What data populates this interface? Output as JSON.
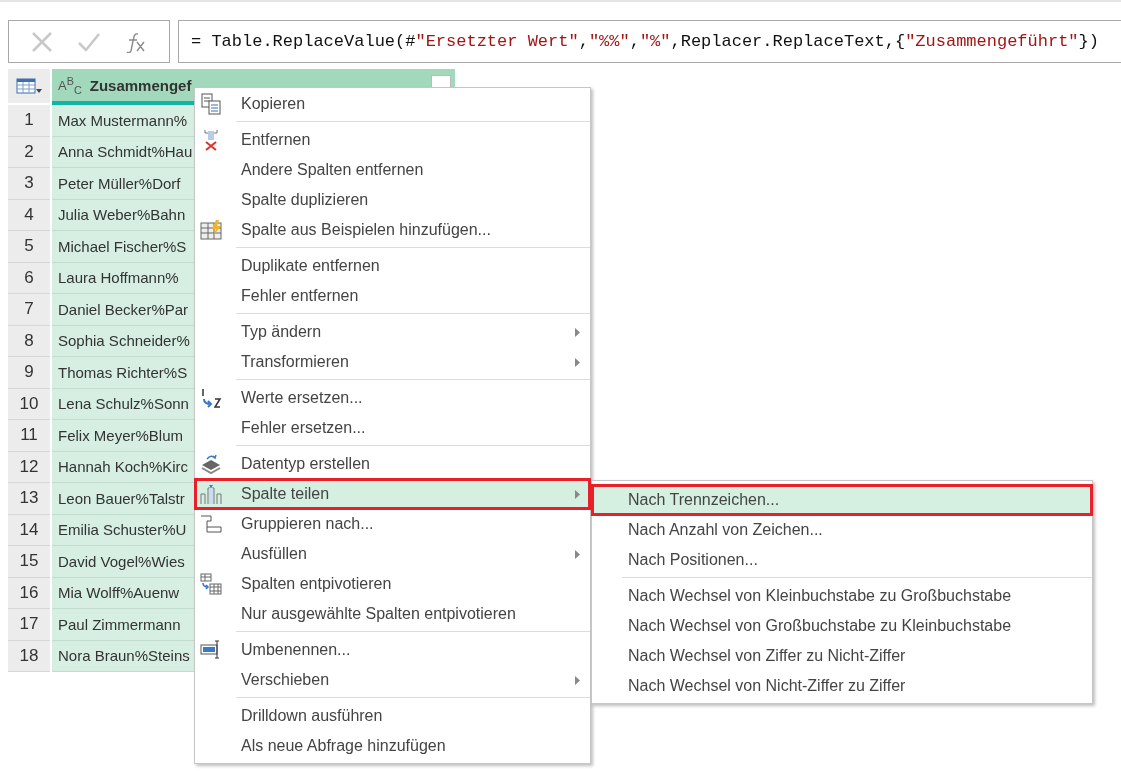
{
  "formula_bar": {
    "segments": [
      {
        "kind": "code",
        "text": "= Table.ReplaceValue(#"
      },
      {
        "kind": "string",
        "text": "\"Ersetzter Wert\""
      },
      {
        "kind": "code",
        "text": ","
      },
      {
        "kind": "string",
        "text": "\"%%\""
      },
      {
        "kind": "code",
        "text": ","
      },
      {
        "kind": "string",
        "text": "\"%\""
      },
      {
        "kind": "code",
        "text": ",Replacer.ReplaceText,{"
      },
      {
        "kind": "string",
        "text": "\"Zusammengeführt\""
      },
      {
        "kind": "code",
        "text": "})"
      }
    ]
  },
  "table": {
    "column": {
      "type_label": "A$^{B}$$_{C}$",
      "title": "Zusammengef"
    },
    "rows": [
      {
        "index": "1",
        "value": "Max Mustermann%"
      },
      {
        "index": "2",
        "value": "Anna Schmidt%Hau"
      },
      {
        "index": "3",
        "value": "Peter Müller%Dorf"
      },
      {
        "index": "4",
        "value": "Julia Weber%Bahn"
      },
      {
        "index": "5",
        "value": "Michael Fischer%S"
      },
      {
        "index": "6",
        "value": "Laura Hoffmann%"
      },
      {
        "index": "7",
        "value": "Daniel Becker%Par"
      },
      {
        "index": "8",
        "value": "Sophia Schneider%"
      },
      {
        "index": "9",
        "value": "Thomas Richter%S"
      },
      {
        "index": "10",
        "value": "Lena Schulz%Sonn"
      },
      {
        "index": "11",
        "value": "Felix Meyer%Blum"
      },
      {
        "index": "12",
        "value": "Hannah Koch%Kirc"
      },
      {
        "index": "13",
        "value": "Leon Bauer%Talstr"
      },
      {
        "index": "14",
        "value": "Emilia Schuster%U"
      },
      {
        "index": "15",
        "value": "David Vogel%Wies"
      },
      {
        "index": "16",
        "value": "Mia Wolff%Auenw"
      },
      {
        "index": "17",
        "value": "Paul Zimmermann"
      },
      {
        "index": "18",
        "value": "Nora Braun%Steins"
      }
    ]
  },
  "context_menu": {
    "sections": [
      [
        {
          "label": "Kopieren",
          "submenu": false,
          "selected": false
        }
      ],
      [
        {
          "label": "Entfernen",
          "submenu": false,
          "selected": false
        },
        {
          "label": "Andere Spalten entfernen",
          "submenu": false,
          "selected": false
        },
        {
          "label": "Spalte duplizieren",
          "submenu": false,
          "selected": false
        },
        {
          "label": "Spalte aus Beispielen hinzufügen...",
          "submenu": false,
          "selected": false
        }
      ],
      [
        {
          "label": "Duplikate entfernen",
          "submenu": false,
          "selected": false
        },
        {
          "label": "Fehler entfernen",
          "submenu": false,
          "selected": false
        }
      ],
      [
        {
          "label": "Typ ändern",
          "submenu": true,
          "selected": false
        },
        {
          "label": "Transformieren",
          "submenu": true,
          "selected": false
        }
      ],
      [
        {
          "label": "Werte ersetzen...",
          "submenu": false,
          "selected": false
        },
        {
          "label": "Fehler ersetzen...",
          "submenu": false,
          "selected": false
        }
      ],
      [
        {
          "label": "Datentyp erstellen",
          "submenu": false,
          "selected": false
        },
        {
          "label": "Spalte teilen",
          "submenu": true,
          "selected": true
        },
        {
          "label": "Gruppieren nach...",
          "submenu": false,
          "selected": false
        },
        {
          "label": "Ausfüllen",
          "submenu": true,
          "selected": false
        },
        {
          "label": "Spalten entpivotieren",
          "submenu": false,
          "selected": false
        },
        {
          "label": "Nur ausgewählte Spalten entpivotieren",
          "submenu": false,
          "selected": false
        }
      ],
      [
        {
          "label": "Umbenennen...",
          "submenu": false,
          "selected": false
        },
        {
          "label": "Verschieben",
          "submenu": true,
          "selected": false
        }
      ],
      [
        {
          "label": "Drilldown ausführen",
          "submenu": false,
          "selected": false
        },
        {
          "label": "Als neue Abfrage hinzufügen",
          "submenu": false,
          "selected": false
        }
      ]
    ]
  },
  "submenu": {
    "sections": [
      [
        {
          "label": "Nach Trennzeichen...",
          "selected": true
        },
        {
          "label": "Nach Anzahl von Zeichen...",
          "selected": false
        },
        {
          "label": "Nach Positionen...",
          "selected": false
        }
      ],
      [
        {
          "label": "Nach Wechsel von Kleinbuchstabe zu Großbuchstabe",
          "selected": false
        },
        {
          "label": "Nach Wechsel von Großbuchstabe zu Kleinbuchstabe",
          "selected": false
        },
        {
          "label": "Nach Wechsel von Ziffer zu Nicht-Ziffer",
          "selected": false
        },
        {
          "label": "Nach Wechsel von Nicht-Ziffer zu Ziffer",
          "selected": false
        }
      ]
    ]
  }
}
